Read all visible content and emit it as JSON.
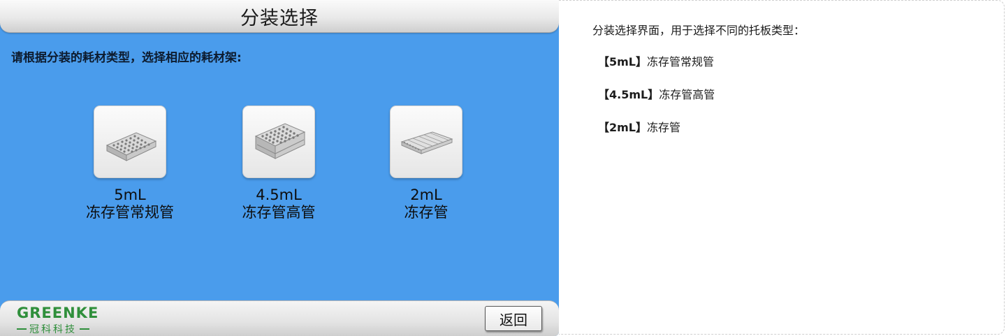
{
  "screen": {
    "title": "分装选择",
    "instruction": "请根据分装的耗材类型，选择相应的耗材架:",
    "options": [
      {
        "volume": "5mL",
        "name": "冻存管常规管",
        "icon": "tube-rack-regular-icon"
      },
      {
        "volume": "4.5mL",
        "name": "冻存管高管",
        "icon": "tube-rack-tall-icon"
      },
      {
        "volume": "2mL",
        "name": "冻存管",
        "icon": "tube-rack-shallow-icon"
      }
    ],
    "logo": {
      "word": "GREENKE",
      "cn": "冠科科技"
    },
    "back_label": "返回"
  },
  "description": {
    "intro": "分装选择界面，用于选择不同的托板类型：",
    "items": [
      {
        "tag": "【5mL】",
        "text": "冻存管常规管"
      },
      {
        "tag": "【4.5mL】",
        "text": "冻存管高管"
      },
      {
        "tag": "【2mL】",
        "text": "冻存管"
      }
    ]
  },
  "colors": {
    "screen_bg": "#4a9cec",
    "brand_green": "#2f8f3b"
  }
}
